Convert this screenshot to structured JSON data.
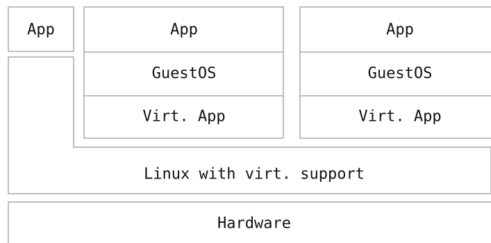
{
  "stack": {
    "hardware_label": "Hardware",
    "host_os_label": "Linux with virt. support",
    "native_app_label": "App",
    "vms": [
      {
        "app_label": "App",
        "guest_os_label": "GuestOS",
        "virt_app_label": "Virt. App"
      },
      {
        "app_label": "App",
        "guest_os_label": "GuestOS",
        "virt_app_label": "Virt. App"
      }
    ]
  }
}
